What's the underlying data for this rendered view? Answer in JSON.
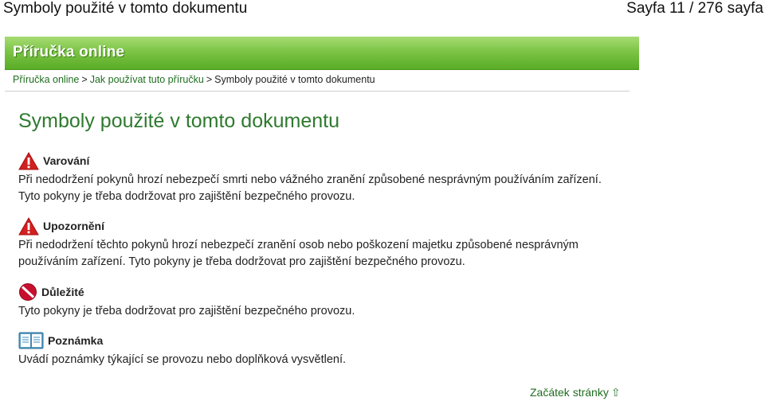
{
  "header": {
    "title": "Symboly použité v tomto dokumentu",
    "page_indicator": "Sayfa 11 / 276 sayfa"
  },
  "banner": {
    "title": "Příručka online"
  },
  "breadcrumb": {
    "items": [
      "Příručka online",
      "Jak používat tuto příručku",
      "Symboly použité v tomto dokumentu"
    ],
    "separator": ">"
  },
  "page": {
    "heading": "Symboly použité v tomto dokumentu"
  },
  "sections": [
    {
      "icon": "warning-icon",
      "label": "Varování",
      "text": "Při nedodržení pokynů hrozí nebezpečí smrti nebo vážného zranění způsobené nesprávným používáním zařízení. Tyto pokyny je třeba dodržovat pro zajištění bezpečného provozu."
    },
    {
      "icon": "caution-icon",
      "label": "Upozornění",
      "text": "Při nedodržení těchto pokynů hrozí nebezpečí zranění osob nebo poškození majetku způsobené nesprávným používáním zařízení. Tyto pokyny je třeba dodržovat pro zajištění bezpečného provozu."
    },
    {
      "icon": "important-icon",
      "label": "Důležité",
      "text": "Tyto pokyny je třeba dodržovat pro zajištění bezpečného provozu."
    },
    {
      "icon": "note-book-icon",
      "label": "Poznámka",
      "text": "Uvádí poznámky týkající se provozu nebo doplňková vysvětlení."
    }
  ],
  "footer": {
    "top_link": "Začátek stránky",
    "top_arrow": "⇧"
  },
  "colors": {
    "banner_green": "#7cc446",
    "heading_green": "#2f7a2f",
    "link_green": "#1f6d1f",
    "warning_red": "#d21f1f"
  }
}
